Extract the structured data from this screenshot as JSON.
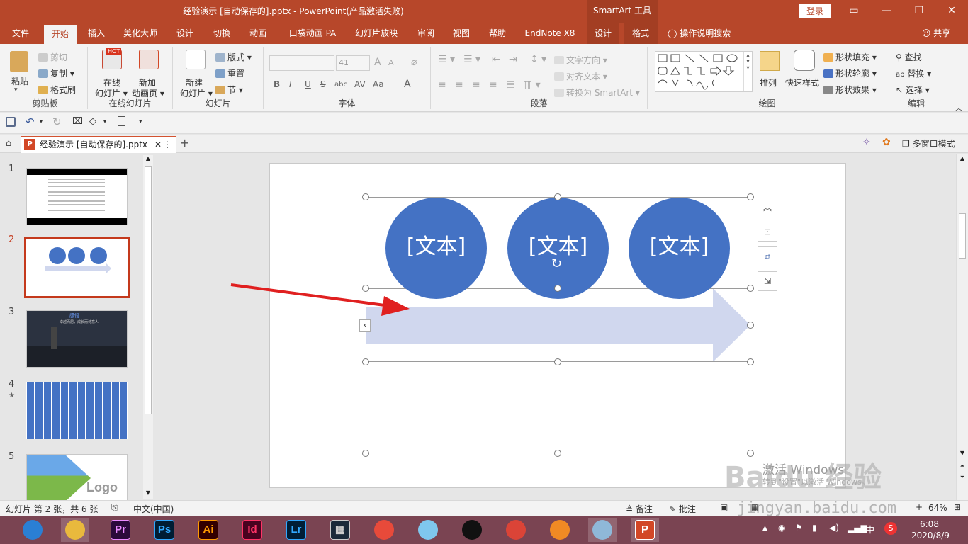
{
  "app": {
    "title": "经验演示 [自动保存的].pptx  -  PowerPoint(产品激活失败)",
    "context_tab": "SmartArt 工具",
    "login_label": "登录",
    "window_buttons": [
      "▭",
      "—",
      "❐",
      "✕"
    ]
  },
  "ribbon_tabs": [
    "文件",
    "开始",
    "插入",
    "美化大师",
    "设计",
    "切换",
    "动画",
    "口袋动画 PA",
    "幻灯片放映",
    "审阅",
    "视图",
    "帮助",
    "EndNote X8",
    "设计",
    "格式"
  ],
  "active_tab": "开始",
  "tell_me": "操作说明搜索",
  "share": "共享",
  "clipboard": {
    "paste": "粘贴",
    "cut": "剪切",
    "copy": "复制",
    "format_painter": "格式刷",
    "label": "剪贴板"
  },
  "online_slides": {
    "online": "在线幻灯片",
    "online_short": "在线",
    "online_line2": "幻灯片",
    "new_anim": "新加",
    "new_anim_line2": "动画页",
    "hot_badge": "HOT",
    "label": "在线幻灯片"
  },
  "slides_group": {
    "new_slide": "新建",
    "new_slide_line2": "幻灯片",
    "layout": "版式",
    "reset": "重置",
    "section": "节",
    "label": "幻灯片"
  },
  "font_group": {
    "font_size": "41",
    "bold": "B",
    "italic": "I",
    "underline": "U",
    "strike": "S",
    "shadow": "abc",
    "spacing": "AV",
    "case": "Aa",
    "color": "A",
    "grow": "A",
    "shrink": "A",
    "label": "字体"
  },
  "paragraph_group": {
    "text_direction": "文字方向",
    "align_text": "对齐文本",
    "convert_smartart": "转换为 SmartArt",
    "label": "段落"
  },
  "drawing_group": {
    "arrange": "排列",
    "quick_styles": "快速样式",
    "shape_fill": "形状填充",
    "shape_outline": "形状轮廓",
    "shape_effects": "形状效果",
    "label": "绘图"
  },
  "editing_group": {
    "find": "查找",
    "replace": "替换",
    "select": "选择",
    "label": "编辑"
  },
  "doc_tab": {
    "name": "经验演示 [自动保存的].pptx",
    "multi_window": "多窗口模式"
  },
  "thumbnails": [
    {
      "num": "1"
    },
    {
      "num": "2"
    },
    {
      "num": "3",
      "caption": "感悟",
      "subcaption": "卓越而居，成长而诗意人"
    },
    {
      "num": "4",
      "star": "★"
    },
    {
      "num": "5",
      "logo": "Logo"
    }
  ],
  "current_slide_index": 2,
  "slide": {
    "circles": [
      "[文本]",
      "[文本]",
      "[文本]"
    ],
    "colors": {
      "circle": "#4472c4",
      "arrow": "#d0d7ee",
      "annotation_arrow": "#e02020"
    },
    "watermark_activate": "激活 Windows",
    "watermark_activate_sub": "转到\"设置\"以激活 Windows。"
  },
  "status": {
    "slide_info": "幻灯片 第 2 张，共 6 张",
    "language": "中文(中国)",
    "notes": "备注",
    "comments": "批注",
    "zoom": "64%",
    "plus": "+"
  },
  "watermark": {
    "brand": "Baidu 经验",
    "url": "jingyan.baidu.com"
  },
  "taskbar": {
    "apps": [
      {
        "icon": "browser-icon",
        "label": "",
        "color": "#2a7fd4"
      },
      {
        "icon": "folder-icon",
        "label": "",
        "color": "#e9b93d"
      },
      {
        "icon": "premiere-icon",
        "label": "Pr",
        "color": "#2a0a3a",
        "fg": "#e98aff"
      },
      {
        "icon": "photoshop-icon",
        "label": "Ps",
        "color": "#001d34",
        "fg": "#31a8ff"
      },
      {
        "icon": "illustrator-icon",
        "label": "Ai",
        "color": "#330000",
        "fg": "#ff9a00"
      },
      {
        "icon": "indesign-icon",
        "label": "Id",
        "color": "#49021f",
        "fg": "#ff3366"
      },
      {
        "icon": "lightroom-icon",
        "label": "Lr",
        "color": "#001e36",
        "fg": "#31a8ff"
      },
      {
        "icon": "video-icon",
        "label": "▦",
        "color": "#1a2a3a",
        "fg": "#cccccc"
      },
      {
        "icon": "wps-icon",
        "label": "",
        "color": "#e84a3a"
      },
      {
        "icon": "paint-icon",
        "label": "",
        "color": "#7fc7ee"
      },
      {
        "icon": "qq-icon",
        "label": "",
        "color": "#111111"
      },
      {
        "icon": "chrome-icon",
        "label": "",
        "color": "#db4437"
      },
      {
        "icon": "sogou-icon",
        "label": "",
        "color": "#f08a24"
      },
      {
        "icon": "notes-icon",
        "label": "",
        "color": "#8fb8d8"
      },
      {
        "icon": "powerpoint-icon",
        "label": "P",
        "color": "#d24726",
        "fg": "#ffffff"
      }
    ],
    "tray_lang": "中",
    "time": "6:08",
    "date": "2020/8/9"
  }
}
